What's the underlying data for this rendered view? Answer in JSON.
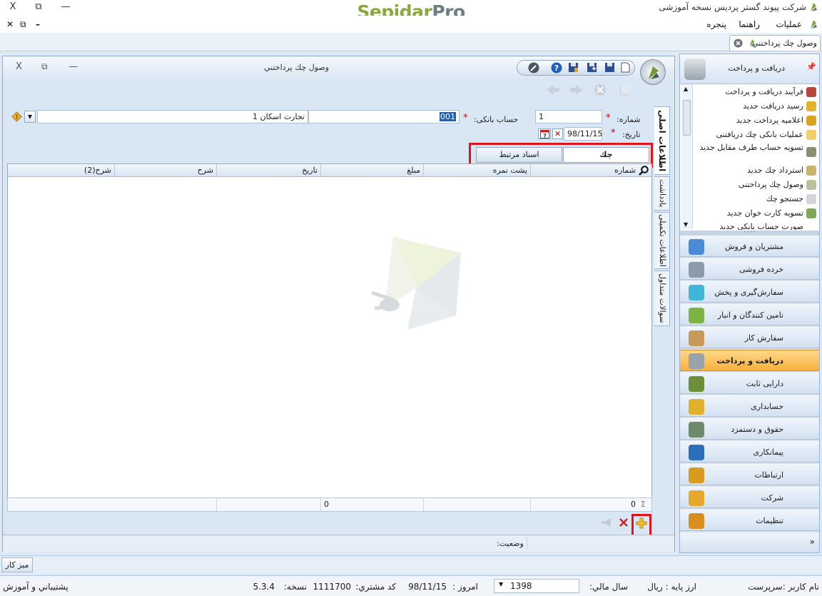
{
  "window": {
    "app_title": "شرکت پیوند گستر پردیس نسخه آموزشی",
    "logo_part1": "Sepidar",
    "logo_part2": "Pro",
    "controls": {
      "close": "X",
      "restore": "⧉",
      "minimize": "—"
    }
  },
  "menu": {
    "items": [
      "عملیات",
      "راهنما",
      "پنجره"
    ],
    "mdi_controls": {
      "close": "✕",
      "restore": "⧉",
      "minimize": "–"
    }
  },
  "doc_tab": {
    "label": "وصول چك پرداختني"
  },
  "form": {
    "title": "وصول چك پرداختني",
    "number_label": "شماره:",
    "number_value": "1",
    "bank_label": "حساب بانكی:",
    "bank_code": "001",
    "bank_name": "تجارت اسکان 1",
    "date_label": "تاریخ:",
    "date_value": "98/11/15",
    "tabs": {
      "cheque": "چك",
      "related": "اسناد مرتبط"
    },
    "side_tabs": [
      "اطلاعات اصلی",
      "یادداشت",
      "اطلاعات تکمیلی",
      "سوالات متداول"
    ],
    "grid_columns": [
      "شماره",
      "پشت نمره",
      "مبلغ",
      "تاریخ",
      "شرح",
      "شرح(2)"
    ],
    "grid_footer": {
      "count": "0",
      "amount": "0"
    },
    "status_label": "وضعیت:"
  },
  "nav": {
    "header": "دریافت و پرداخت",
    "items": [
      "فرآیند دریافت و پرداخت",
      "رسید دریافت جدید",
      "اعلامیه پرداخت جدید",
      "عملیات بانكی چك دریافتنی",
      "تسویه حساب طرف مقابل جدید",
      "استرداد چك جدید",
      "وصول چك پرداختنی",
      "جستجو چك",
      "تسویه کارت خوان جدید",
      "صورت حساب بانکی جدید"
    ],
    "modules": [
      {
        "label": "مشتریان و فروش",
        "color": "#4b8ad6"
      },
      {
        "label": "خرده فروشی",
        "color": "#8c9bab"
      },
      {
        "label": "سفارش‌گیری و پخش",
        "color": "#3fb6d8"
      },
      {
        "label": "تامین کنندگان و انبار",
        "color": "#7cb342"
      },
      {
        "label": "سفارش کار",
        "color": "#c79a5a"
      },
      {
        "label": "دریافت و پرداخت",
        "color": "#9aa3ab"
      },
      {
        "label": "دارایی ثابت",
        "color": "#6d8f3a"
      },
      {
        "label": "حسابداری",
        "color": "#e0b12a"
      },
      {
        "label": "حقوق و دستمزد",
        "color": "#6f8a6a"
      },
      {
        "label": "پیمانکاری",
        "color": "#2a6fb8"
      },
      {
        "label": "ارتباطات",
        "color": "#d99a1e"
      },
      {
        "label": "شرکت",
        "color": "#e6a82a"
      },
      {
        "label": "تنظیمات",
        "color": "#d98e1e"
      }
    ],
    "active_module": 5
  },
  "taskbar": {
    "desk_button": "میز کار"
  },
  "status": {
    "user": "نام کاربر :سرپرست",
    "currency": "ارز پایه : ریال",
    "fiscal_year_label": "سال مالي:",
    "fiscal_year": "1398",
    "today_label": "امروز :",
    "today": "98/11/15",
    "customer_label": "کد مشتري:",
    "customer": "1111700",
    "version_label": "نسخه:",
    "version": "5.3.4",
    "support": "پشتيباني و آموزش"
  }
}
